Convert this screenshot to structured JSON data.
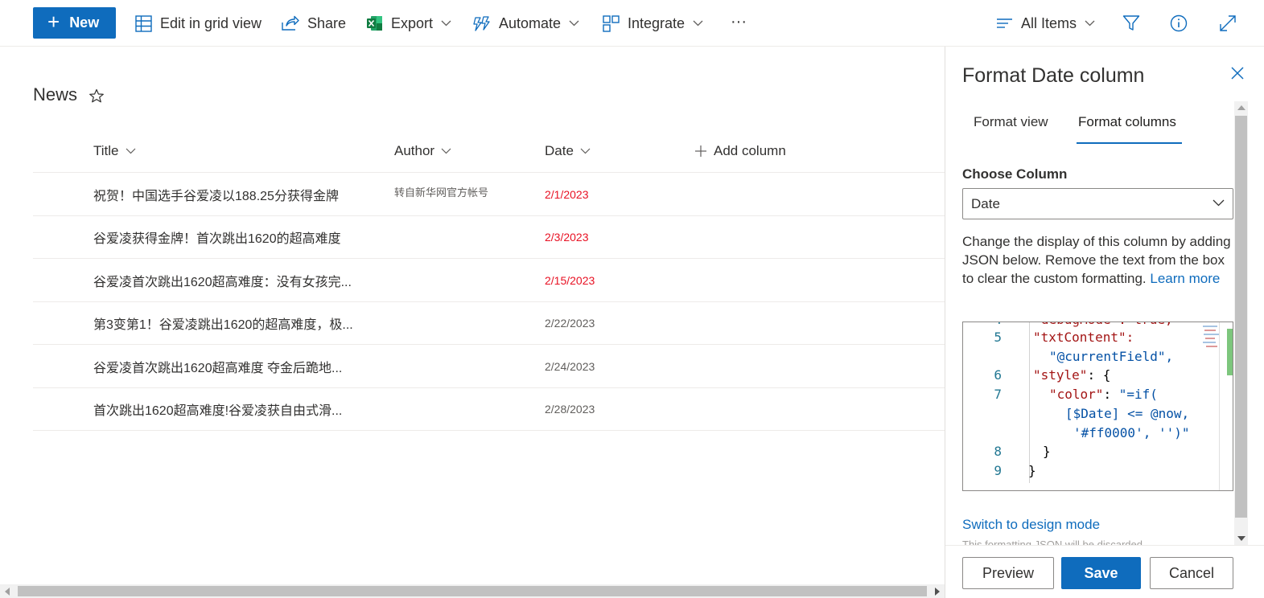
{
  "toolbar": {
    "new_label": "New",
    "edit_grid_label": "Edit in grid view",
    "share_label": "Share",
    "export_label": "Export",
    "automate_label": "Automate",
    "integrate_label": "Integrate",
    "more_label": "···",
    "view_label": "All Items"
  },
  "list": {
    "title": "News",
    "columns": {
      "title": "Title",
      "author": "Author",
      "date": "Date",
      "add": "Add column"
    },
    "rows": [
      {
        "title": "祝贺！中国选手谷爱凌以188.25分获得金牌",
        "author": "转自新华网官方帐号",
        "date": "2/1/2023",
        "past": true
      },
      {
        "title": "谷爱凌获得金牌！首次跳出1620的超高难度",
        "author": "",
        "date": "2/3/2023",
        "past": true
      },
      {
        "title": "谷爱凌首次跳出1620超高难度：没有女孩完...",
        "author": "",
        "date": "2/15/2023",
        "past": true
      },
      {
        "title": "第3变第1！谷爱凌跳出1620的超高难度，极...",
        "author": "",
        "date": "2/22/2023",
        "past": false
      },
      {
        "title": "谷爱凌首次跳出1620超高难度 夺金后跪地...",
        "author": "",
        "date": "2/24/2023",
        "past": false
      },
      {
        "title": "首次跳出1620超高难度!谷爱凌获自由式滑...",
        "author": "",
        "date": "2/28/2023",
        "past": false
      }
    ]
  },
  "panel": {
    "title": "Format Date column",
    "tabs": {
      "view": "Format view",
      "columns": "Format columns"
    },
    "choose_label": "Choose Column",
    "selected_column": "Date",
    "description": "Change the display of this column by adding JSON below. Remove the text from the box to clear the custom formatting.",
    "learn_more": "Learn more",
    "code_lines": [
      {
        "num": "5",
        "text": "\"txtContent\":"
      },
      {
        "num": "",
        "text": "\"@currentField\","
      },
      {
        "num": "6",
        "text": "\"style\": {"
      },
      {
        "num": "7",
        "text": "\"color\": \"=if("
      },
      {
        "num": "",
        "text": "[$Date] <= @now,"
      },
      {
        "num": "",
        "text": "'#ff0000', '')\""
      },
      {
        "num": "8",
        "text": "}"
      },
      {
        "num": "9",
        "text": "}"
      }
    ],
    "switch_label": "Switch to design mode",
    "note": "This formatting JSON will be discarded",
    "buttons": {
      "preview": "Preview",
      "save": "Save",
      "cancel": "Cancel"
    }
  },
  "colors": {
    "accent": "#0f6cbd",
    "past_date": "#e81123"
  }
}
